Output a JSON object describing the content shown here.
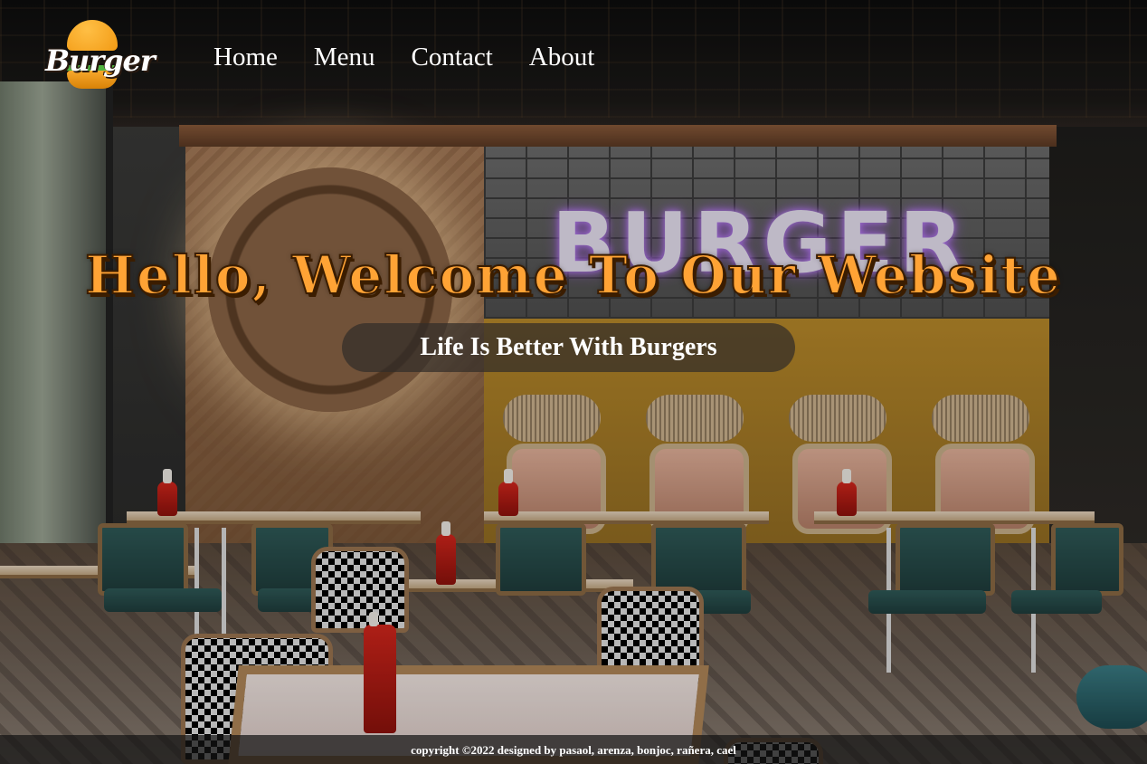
{
  "brand": {
    "logo_text": "Burger"
  },
  "nav": {
    "items": [
      {
        "label": "Home"
      },
      {
        "label": "Menu"
      },
      {
        "label": "Contact"
      },
      {
        "label": "About"
      }
    ]
  },
  "hero": {
    "neon_sign": "BURGER",
    "title": "Hello, Welcome To Our Website",
    "subtitle": "Life Is Better With Burgers"
  },
  "footer": {
    "copyright": "copyright ©2022 designed by pasaol, arenza, bonjoc, rañera, cael"
  },
  "colors": {
    "title": "#ffa335",
    "title_outline": "#3b1d00",
    "nav_text": "#ffffff",
    "subtitle_pill": "#322d28"
  }
}
